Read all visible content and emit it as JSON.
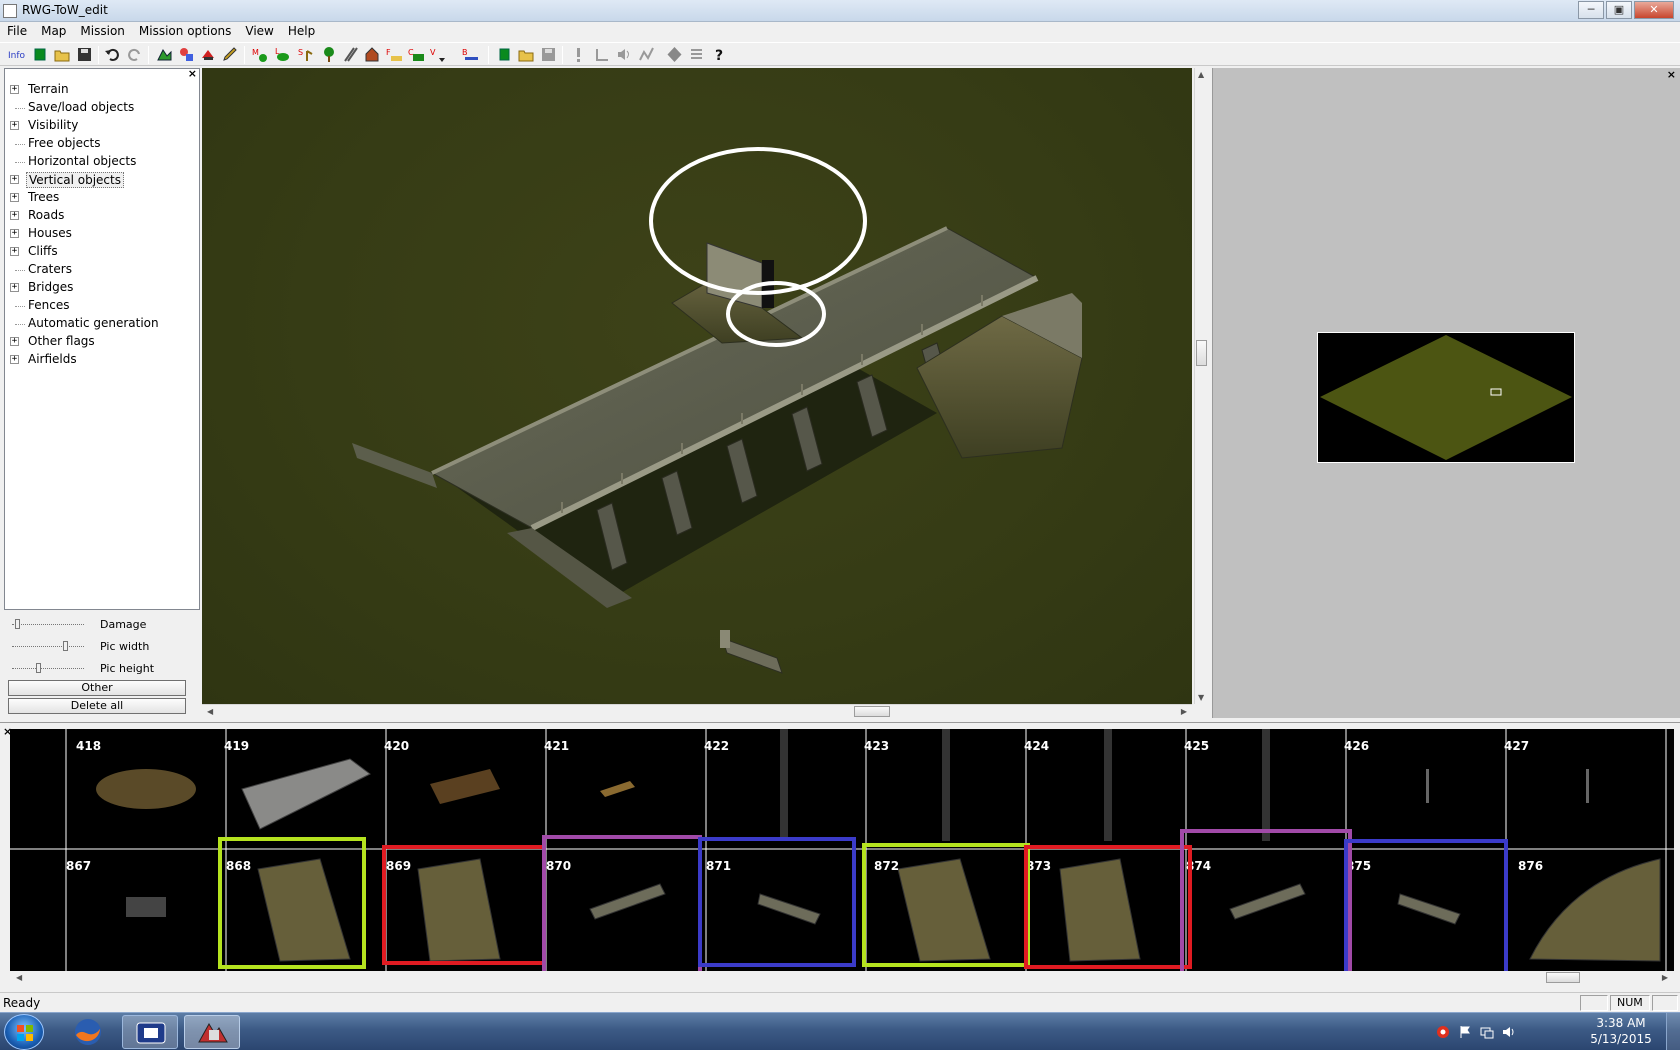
{
  "window": {
    "title": "RWG-ToW_edit",
    "minimize": "─",
    "maximize": "▣",
    "close": "✕"
  },
  "menu": [
    "File",
    "Map",
    "Mission",
    "Mission options",
    "View",
    "Help"
  ],
  "toolbar": {
    "info_label": "Info"
  },
  "tree": {
    "close": "×",
    "items": [
      {
        "label": "Terrain",
        "expandable": true
      },
      {
        "label": "Save/load objects",
        "expandable": false
      },
      {
        "label": "Visibility",
        "expandable": true
      },
      {
        "label": "Free objects",
        "expandable": false
      },
      {
        "label": "Horizontal objects",
        "expandable": false
      },
      {
        "label": "Vertical objects",
        "expandable": true,
        "selected": true
      },
      {
        "label": "Trees",
        "expandable": true
      },
      {
        "label": "Roads",
        "expandable": true
      },
      {
        "label": "Houses",
        "expandable": true
      },
      {
        "label": "Cliffs",
        "expandable": true
      },
      {
        "label": "Craters",
        "expandable": false
      },
      {
        "label": "Bridges",
        "expandable": true
      },
      {
        "label": "Fences",
        "expandable": false
      },
      {
        "label": "Automatic generation",
        "expandable": false
      },
      {
        "label": "Other flags",
        "expandable": true
      },
      {
        "label": "Airfields",
        "expandable": true
      }
    ],
    "expander_symbol": "+"
  },
  "sliders": [
    {
      "label": "Damage",
      "level": 0.05
    },
    {
      "label": "Pic width",
      "level": 0.75
    },
    {
      "label": "Pic height",
      "level": 0.35
    }
  ],
  "buttons": {
    "other": "Other",
    "delete_all": "Delete all"
  },
  "minimap_close": "×",
  "object_strip": {
    "close": "×",
    "top_row": [
      "418",
      "419",
      "420",
      "421",
      "422",
      "423",
      "424",
      "425",
      "426",
      "427"
    ],
    "bottom_row": [
      "867",
      "868",
      "869",
      "870",
      "871",
      "872",
      "873",
      "874",
      "875",
      "876"
    ],
    "highlight_colors": {
      "green": "#b5e31f",
      "red": "#e01b22",
      "purple": "#a14aa8",
      "blue": "#3b3bc9"
    }
  },
  "status": {
    "text": "Ready",
    "num": "NUM"
  },
  "taskbar": {
    "time": "3:38 AM",
    "date": "5/13/2015"
  },
  "colors": {
    "terrain": "#373d16",
    "minimap_land": "#4c5512",
    "annotation": "#ffffff"
  }
}
